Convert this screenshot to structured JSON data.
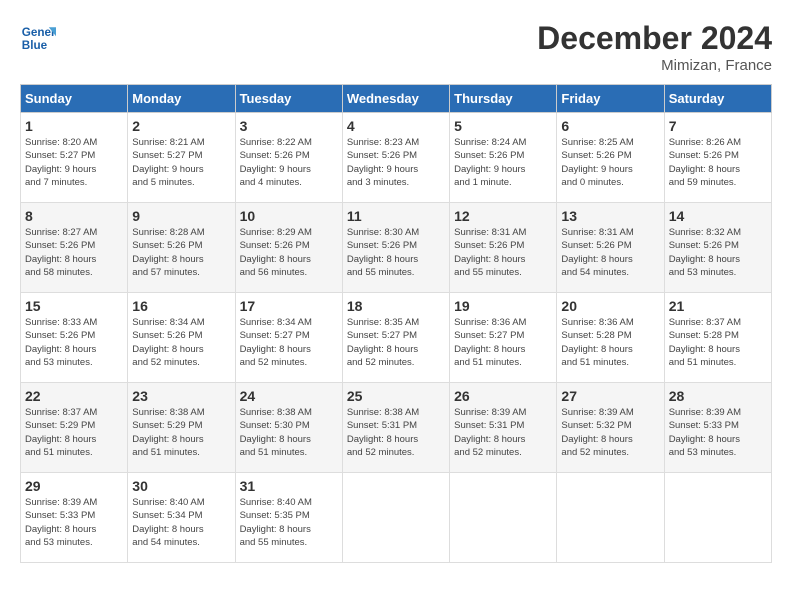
{
  "header": {
    "logo_line1": "General",
    "logo_line2": "Blue",
    "month_title": "December 2024",
    "location": "Mimizan, France"
  },
  "weekdays": [
    "Sunday",
    "Monday",
    "Tuesday",
    "Wednesday",
    "Thursday",
    "Friday",
    "Saturday"
  ],
  "weeks": [
    [
      {
        "day": "1",
        "info": "Sunrise: 8:20 AM\nSunset: 5:27 PM\nDaylight: 9 hours\nand 7 minutes."
      },
      {
        "day": "2",
        "info": "Sunrise: 8:21 AM\nSunset: 5:27 PM\nDaylight: 9 hours\nand 5 minutes."
      },
      {
        "day": "3",
        "info": "Sunrise: 8:22 AM\nSunset: 5:26 PM\nDaylight: 9 hours\nand 4 minutes."
      },
      {
        "day": "4",
        "info": "Sunrise: 8:23 AM\nSunset: 5:26 PM\nDaylight: 9 hours\nand 3 minutes."
      },
      {
        "day": "5",
        "info": "Sunrise: 8:24 AM\nSunset: 5:26 PM\nDaylight: 9 hours\nand 1 minute."
      },
      {
        "day": "6",
        "info": "Sunrise: 8:25 AM\nSunset: 5:26 PM\nDaylight: 9 hours\nand 0 minutes."
      },
      {
        "day": "7",
        "info": "Sunrise: 8:26 AM\nSunset: 5:26 PM\nDaylight: 8 hours\nand 59 minutes."
      }
    ],
    [
      {
        "day": "8",
        "info": "Sunrise: 8:27 AM\nSunset: 5:26 PM\nDaylight: 8 hours\nand 58 minutes."
      },
      {
        "day": "9",
        "info": "Sunrise: 8:28 AM\nSunset: 5:26 PM\nDaylight: 8 hours\nand 57 minutes."
      },
      {
        "day": "10",
        "info": "Sunrise: 8:29 AM\nSunset: 5:26 PM\nDaylight: 8 hours\nand 56 minutes."
      },
      {
        "day": "11",
        "info": "Sunrise: 8:30 AM\nSunset: 5:26 PM\nDaylight: 8 hours\nand 55 minutes."
      },
      {
        "day": "12",
        "info": "Sunrise: 8:31 AM\nSunset: 5:26 PM\nDaylight: 8 hours\nand 55 minutes."
      },
      {
        "day": "13",
        "info": "Sunrise: 8:31 AM\nSunset: 5:26 PM\nDaylight: 8 hours\nand 54 minutes."
      },
      {
        "day": "14",
        "info": "Sunrise: 8:32 AM\nSunset: 5:26 PM\nDaylight: 8 hours\nand 53 minutes."
      }
    ],
    [
      {
        "day": "15",
        "info": "Sunrise: 8:33 AM\nSunset: 5:26 PM\nDaylight: 8 hours\nand 53 minutes."
      },
      {
        "day": "16",
        "info": "Sunrise: 8:34 AM\nSunset: 5:26 PM\nDaylight: 8 hours\nand 52 minutes."
      },
      {
        "day": "17",
        "info": "Sunrise: 8:34 AM\nSunset: 5:27 PM\nDaylight: 8 hours\nand 52 minutes."
      },
      {
        "day": "18",
        "info": "Sunrise: 8:35 AM\nSunset: 5:27 PM\nDaylight: 8 hours\nand 52 minutes."
      },
      {
        "day": "19",
        "info": "Sunrise: 8:36 AM\nSunset: 5:27 PM\nDaylight: 8 hours\nand 51 minutes."
      },
      {
        "day": "20",
        "info": "Sunrise: 8:36 AM\nSunset: 5:28 PM\nDaylight: 8 hours\nand 51 minutes."
      },
      {
        "day": "21",
        "info": "Sunrise: 8:37 AM\nSunset: 5:28 PM\nDaylight: 8 hours\nand 51 minutes."
      }
    ],
    [
      {
        "day": "22",
        "info": "Sunrise: 8:37 AM\nSunset: 5:29 PM\nDaylight: 8 hours\nand 51 minutes."
      },
      {
        "day": "23",
        "info": "Sunrise: 8:38 AM\nSunset: 5:29 PM\nDaylight: 8 hours\nand 51 minutes."
      },
      {
        "day": "24",
        "info": "Sunrise: 8:38 AM\nSunset: 5:30 PM\nDaylight: 8 hours\nand 51 minutes."
      },
      {
        "day": "25",
        "info": "Sunrise: 8:38 AM\nSunset: 5:31 PM\nDaylight: 8 hours\nand 52 minutes."
      },
      {
        "day": "26",
        "info": "Sunrise: 8:39 AM\nSunset: 5:31 PM\nDaylight: 8 hours\nand 52 minutes."
      },
      {
        "day": "27",
        "info": "Sunrise: 8:39 AM\nSunset: 5:32 PM\nDaylight: 8 hours\nand 52 minutes."
      },
      {
        "day": "28",
        "info": "Sunrise: 8:39 AM\nSunset: 5:33 PM\nDaylight: 8 hours\nand 53 minutes."
      }
    ],
    [
      {
        "day": "29",
        "info": "Sunrise: 8:39 AM\nSunset: 5:33 PM\nDaylight: 8 hours\nand 53 minutes."
      },
      {
        "day": "30",
        "info": "Sunrise: 8:40 AM\nSunset: 5:34 PM\nDaylight: 8 hours\nand 54 minutes."
      },
      {
        "day": "31",
        "info": "Sunrise: 8:40 AM\nSunset: 5:35 PM\nDaylight: 8 hours\nand 55 minutes."
      },
      null,
      null,
      null,
      null
    ]
  ]
}
